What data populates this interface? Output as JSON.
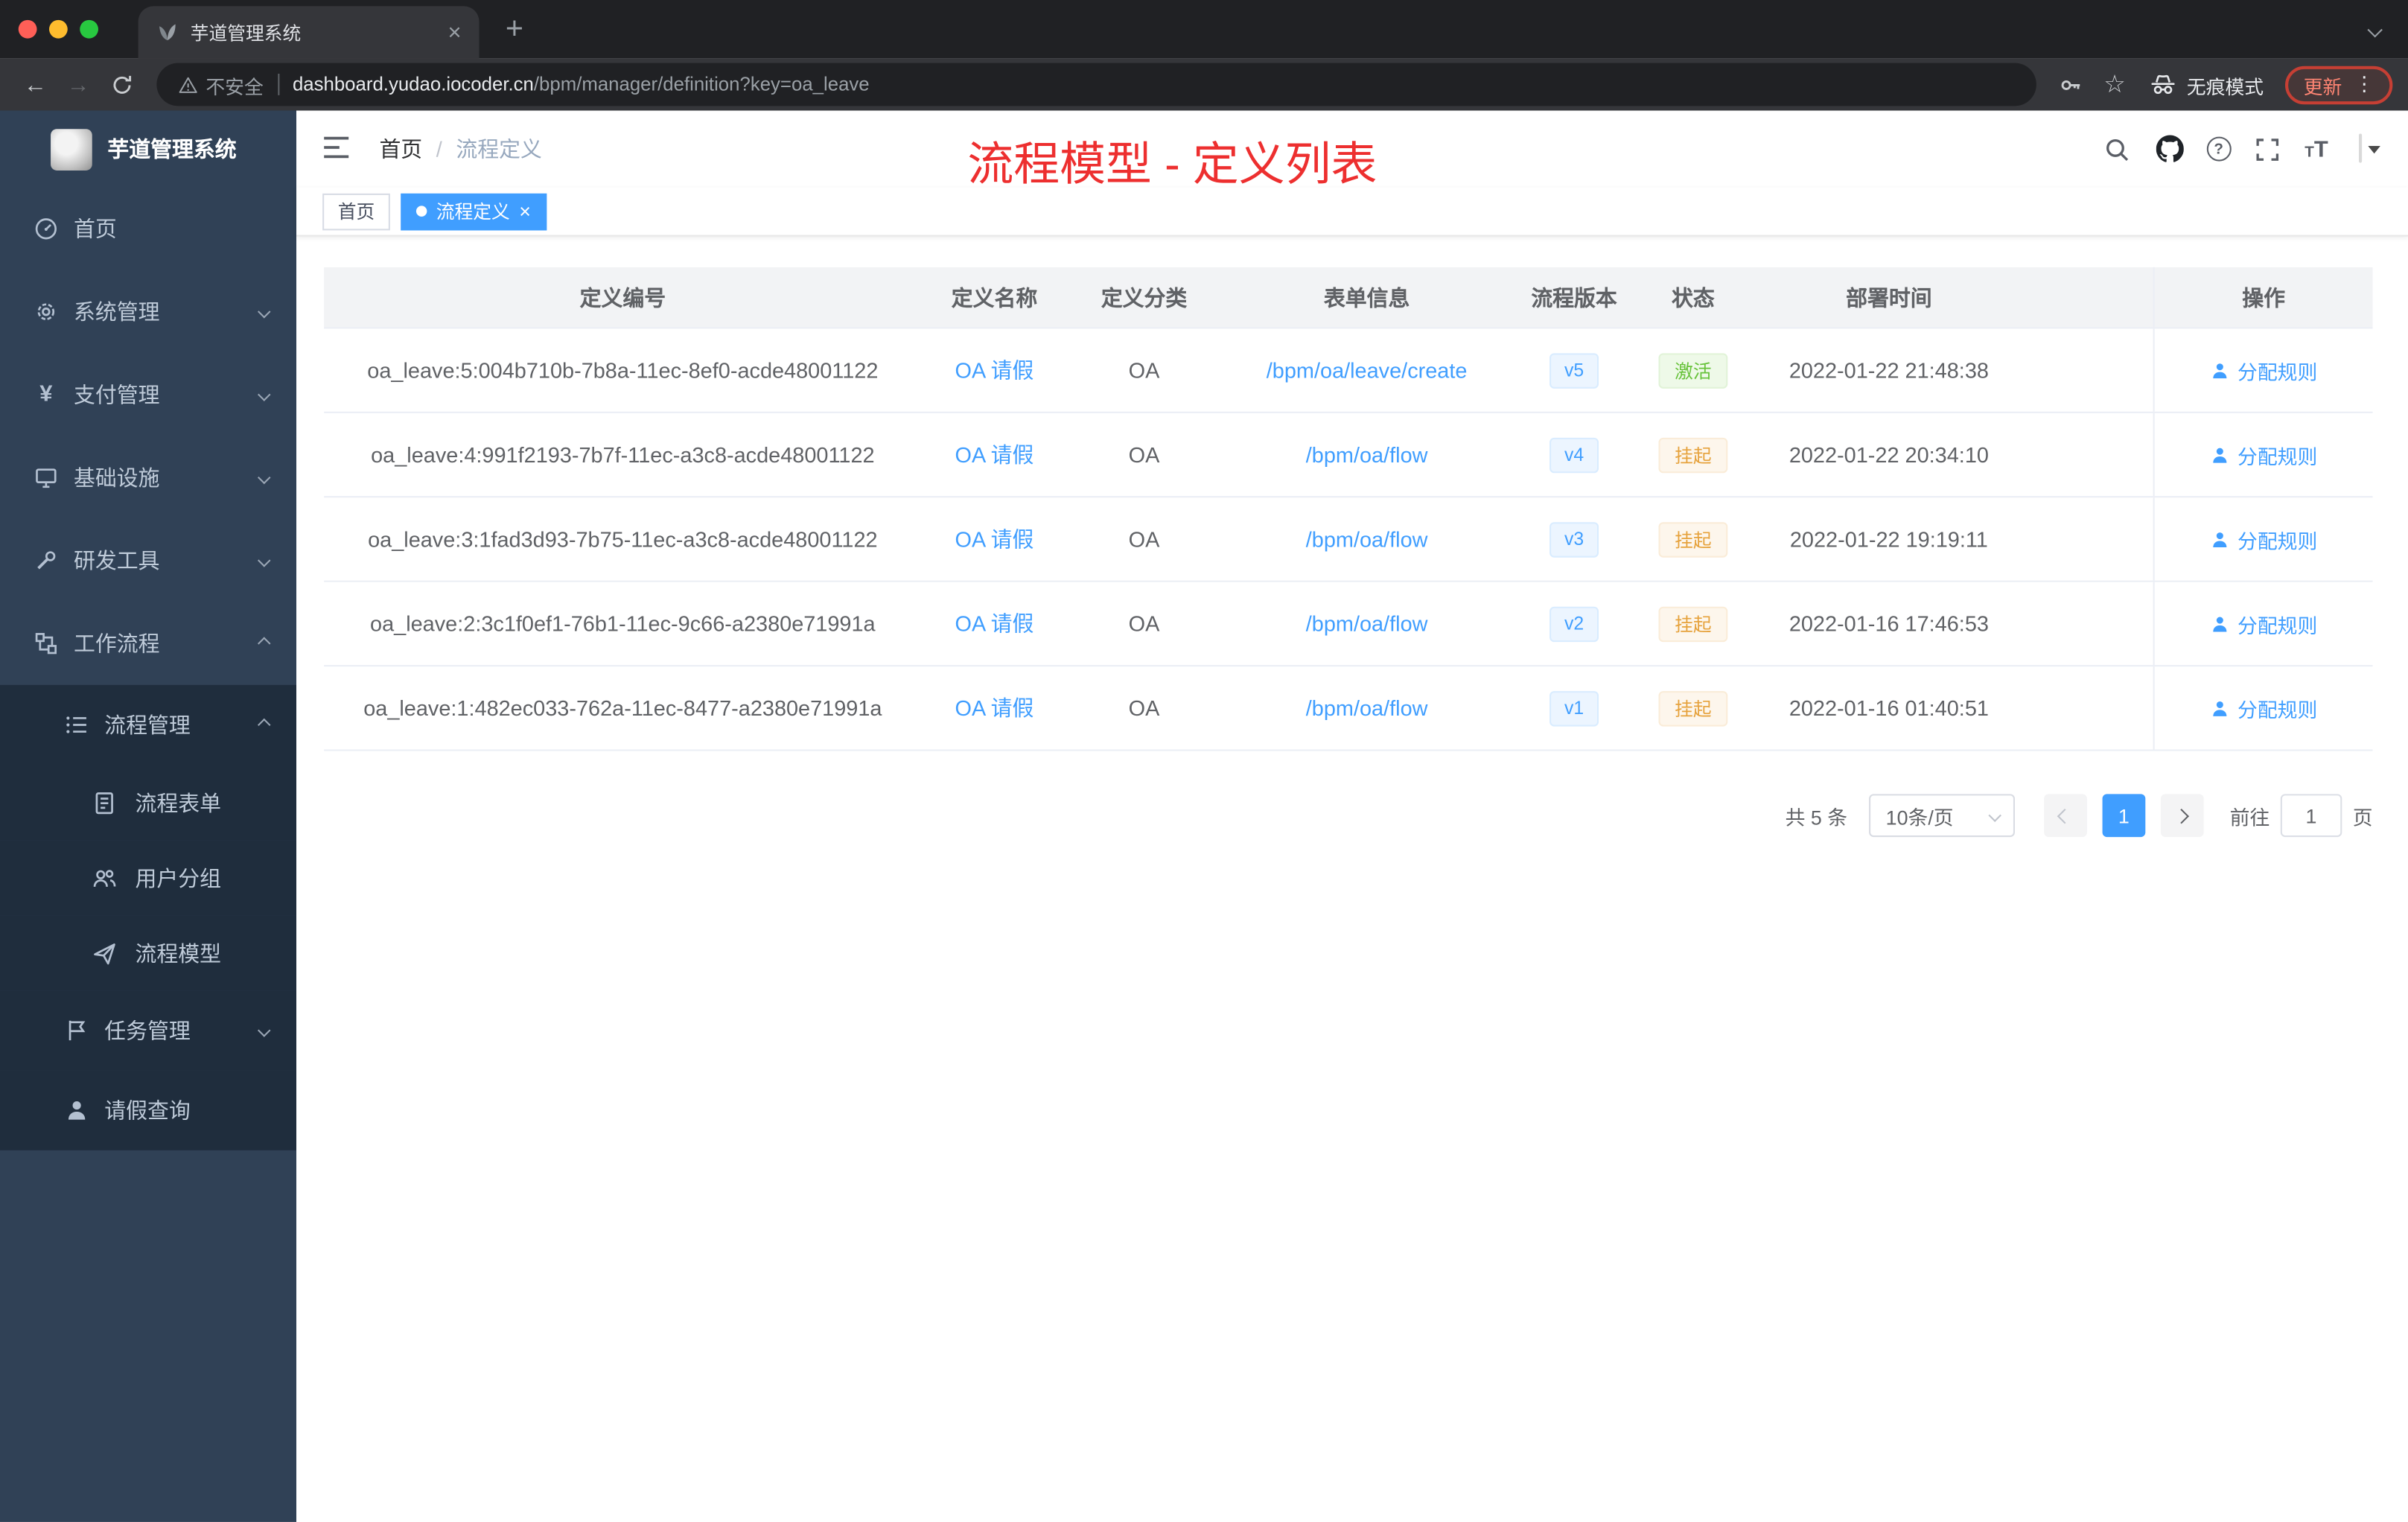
{
  "browser": {
    "tab_title": "芋道管理系统",
    "security_label": "不安全",
    "url_domain": "dashboard.yudao.iocoder.cn",
    "url_path": "/bpm/manager/definition?key=oa_leave",
    "incognito_label": "无痕模式",
    "update_label": "更新"
  },
  "sidebar": {
    "logo_title": "芋道管理系统",
    "menu": [
      {
        "key": "home",
        "label": "首页",
        "icon": "dashboard-icon",
        "level": 1
      },
      {
        "key": "system",
        "label": "系统管理",
        "icon": "gear-icon",
        "level": 1,
        "arrow": "down"
      },
      {
        "key": "payment",
        "label": "支付管理",
        "icon": "yen-icon",
        "level": 1,
        "arrow": "down"
      },
      {
        "key": "infra",
        "label": "基础设施",
        "icon": "infra-icon",
        "level": 1,
        "arrow": "down"
      },
      {
        "key": "devtools",
        "label": "研发工具",
        "icon": "tools-icon",
        "level": 1,
        "arrow": "down"
      },
      {
        "key": "workflow",
        "label": "工作流程",
        "icon": "workflow-icon",
        "level": 1,
        "arrow": "up"
      },
      {
        "key": "process-manage",
        "label": "流程管理",
        "icon": "list-icon",
        "level": 2,
        "arrow": "up",
        "dark": true
      },
      {
        "key": "process-form",
        "label": "流程表单",
        "icon": "form-icon",
        "level": 3,
        "dark": true
      },
      {
        "key": "user-group",
        "label": "用户分组",
        "icon": "users-icon",
        "level": 3,
        "dark": true
      },
      {
        "key": "process-model",
        "label": "流程模型",
        "icon": "send-icon",
        "level": 3,
        "dark": true
      },
      {
        "key": "task-manage",
        "label": "任务管理",
        "icon": "task-icon",
        "level": 2,
        "arrow": "down",
        "dark": true
      },
      {
        "key": "leave-query",
        "label": "请假查询",
        "icon": "person-icon",
        "level": 2,
        "dark": true
      }
    ]
  },
  "header": {
    "breadcrumb": {
      "items": [
        "首页",
        "流程定义"
      ]
    },
    "annotation": "流程模型 - 定义列表"
  },
  "tags": [
    {
      "label": "首页",
      "active": false
    },
    {
      "label": "流程定义",
      "active": true
    }
  ],
  "table": {
    "columns": [
      "定义编号",
      "定义名称",
      "定义分类",
      "表单信息",
      "流程版本",
      "状态",
      "部署时间",
      "操作"
    ],
    "rows": [
      {
        "id": "oa_leave:5:004b710b-7b8a-11ec-8ef0-acde48001122",
        "name": "OA 请假",
        "category": "OA",
        "form": "/bpm/oa/leave/create",
        "version": "v5",
        "status": "激活",
        "status_type": "success",
        "time": "2022-01-22 21:48:38",
        "action": "分配规则"
      },
      {
        "id": "oa_leave:4:991f2193-7b7f-11ec-a3c8-acde48001122",
        "name": "OA 请假",
        "category": "OA",
        "form": "/bpm/oa/flow",
        "version": "v4",
        "status": "挂起",
        "status_type": "warning",
        "time": "2022-01-22 20:34:10",
        "action": "分配规则"
      },
      {
        "id": "oa_leave:3:1fad3d93-7b75-11ec-a3c8-acde48001122",
        "name": "OA 请假",
        "category": "OA",
        "form": "/bpm/oa/flow",
        "version": "v3",
        "status": "挂起",
        "status_type": "warning",
        "time": "2022-01-22 19:19:11",
        "action": "分配规则"
      },
      {
        "id": "oa_leave:2:3c1f0ef1-76b1-11ec-9c66-a2380e71991a",
        "name": "OA 请假",
        "category": "OA",
        "form": "/bpm/oa/flow",
        "version": "v2",
        "status": "挂起",
        "status_type": "warning",
        "time": "2022-01-16 17:46:53",
        "action": "分配规则"
      },
      {
        "id": "oa_leave:1:482ec033-762a-11ec-8477-a2380e71991a",
        "name": "OA 请假",
        "category": "OA",
        "form": "/bpm/oa/flow",
        "version": "v1",
        "status": "挂起",
        "status_type": "warning",
        "time": "2022-01-16 01:40:51",
        "action": "分配规则"
      }
    ]
  },
  "pagination": {
    "total": "共 5 条",
    "page_size": "10条/页",
    "page": "1",
    "goto": "前往",
    "goto_value": "1",
    "unit": "页"
  },
  "colors": {
    "accent": "#409eff",
    "success": "#67c23a",
    "warning": "#e6a23c",
    "annotation_red": "#ed2f2f",
    "sidebar_bg": "#304156",
    "sidebar_sub_bg": "#1f2d3d"
  }
}
